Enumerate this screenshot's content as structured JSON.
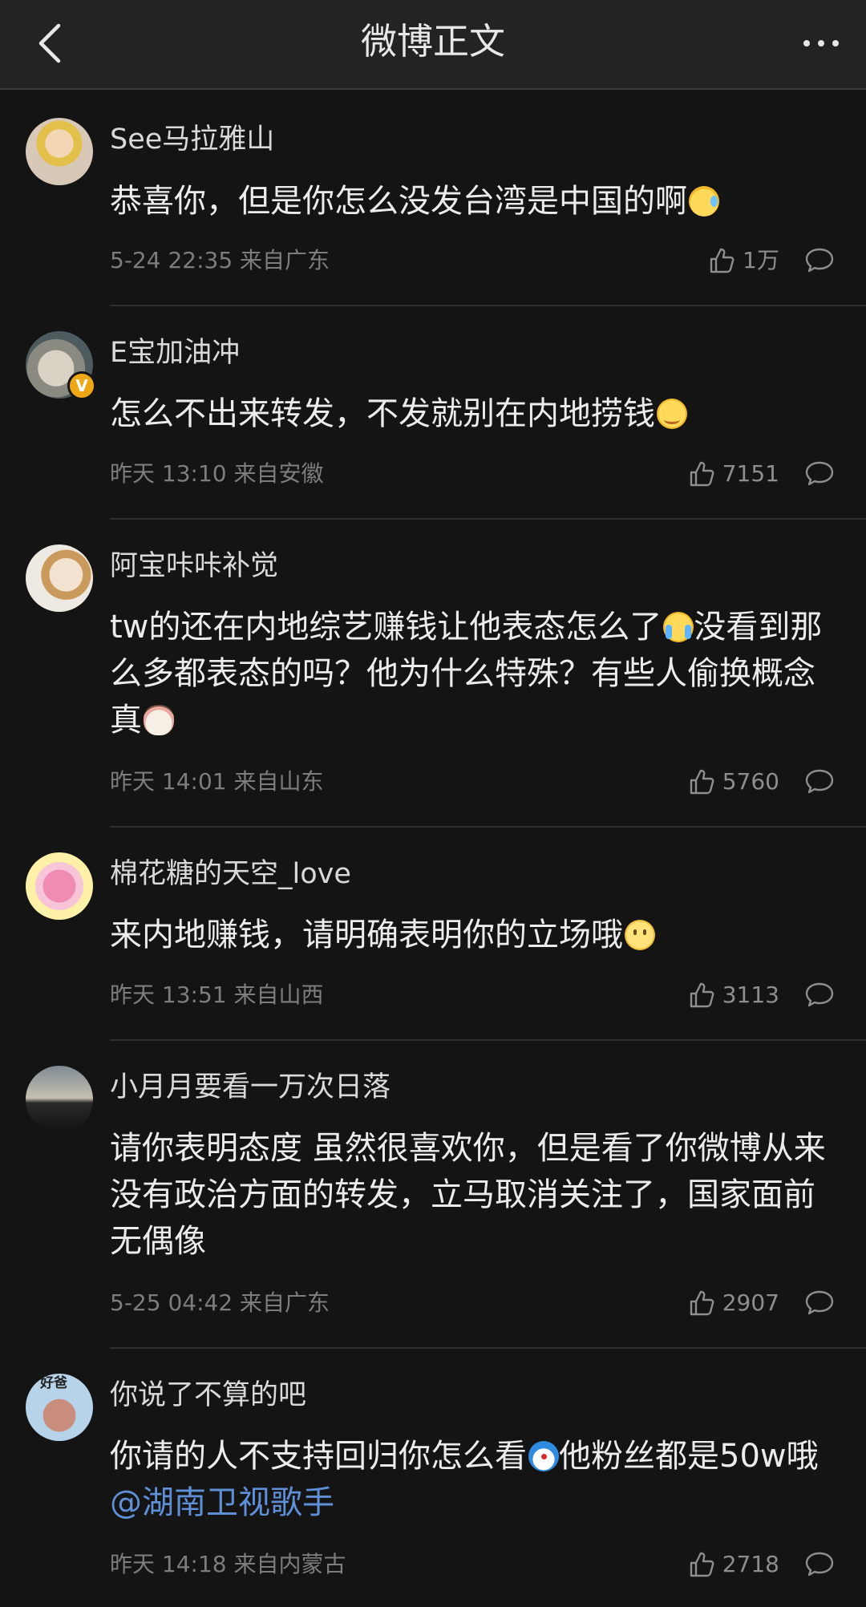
{
  "header": {
    "title": "微博正文"
  },
  "comments": [
    {
      "username": "See马拉雅山",
      "text": "恭喜你，但是你怎么没发台湾是中国的啊",
      "meta": "5-24 22:35 来自广东",
      "likes": "1万",
      "emoji": "cold-sweat-emoji",
      "verified": false
    },
    {
      "username": "E宝加油冲",
      "text": "怎么不出来转发，不发就别在内地捞钱",
      "meta": "昨天 13:10 来自安徽",
      "likes": "7151",
      "emoji": "smile-emoji",
      "verified": true
    },
    {
      "username": "阿宝咔咔补觉",
      "text_a": "tw的还在内地综艺赚钱让他表态怎么了",
      "text_b": "没看到那么多都表态的吗？他为什么特殊？有些人偷换概念真",
      "meta": "昨天 14:01 来自山东",
      "likes": "5760",
      "emoji_a": "crying-emoji",
      "emoji_b": "cow-emoji",
      "verified": false
    },
    {
      "username": "棉花糖的天空_love",
      "text": "来内地赚钱，请明确表明你的立场哦",
      "meta": "昨天 13:51 来自山西",
      "likes": "3113",
      "emoji": "slight-smile-emoji",
      "verified": false
    },
    {
      "username": "小月月要看一万次日落",
      "text": "请你表明态度 虽然很喜欢你，但是看了你微博从来没有政治方面的转发，立马取消关注了，国家面前无偶像",
      "meta": "5-25 04:42 来自广东",
      "likes": "2907",
      "verified": false
    },
    {
      "username": "你说了不算的吧",
      "text_a": "你请的人不支持回归你怎么看",
      "text_b": "他粉丝都是50w哦",
      "mention": "@湖南卫视歌手",
      "meta": "昨天 14:18 来自内蒙古",
      "likes": "2718",
      "emoji": "doraemon-emoji",
      "avatar_badge": "好爸",
      "verified": false
    }
  ],
  "colors": {
    "background": "#141414",
    "topbar": "#232323",
    "mention": "#5f8fd6",
    "verified_badge": "#f0a716"
  }
}
